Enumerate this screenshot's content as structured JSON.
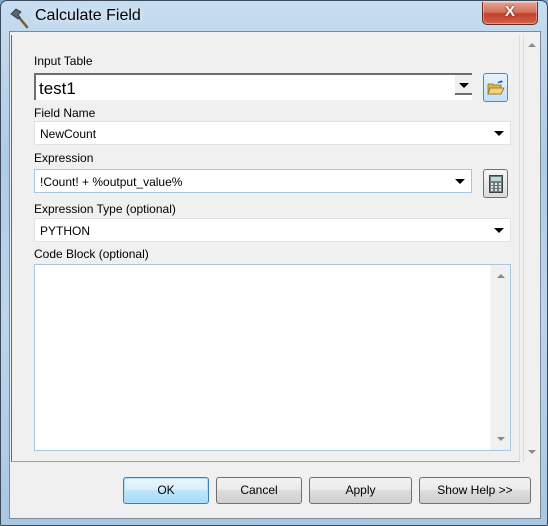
{
  "window": {
    "title": "Calculate Field",
    "title_icon": "hammer-icon",
    "close_label": "X"
  },
  "form": {
    "input_table": {
      "label": "Input Table",
      "value": "test1",
      "browse_icon": "open-folder-icon"
    },
    "field_name": {
      "label": "Field Name",
      "value": "NewCount"
    },
    "expression": {
      "label": "Expression",
      "value": "!Count! + %output_value%",
      "calculator_icon": "calculator-icon"
    },
    "expression_type": {
      "label": "Expression Type (optional)",
      "value": "PYTHON"
    },
    "code_block": {
      "label": "Code Block (optional)",
      "value": ""
    }
  },
  "buttons": {
    "ok": "OK",
    "cancel": "Cancel",
    "apply": "Apply",
    "show_help": "Show Help >>"
  },
  "colors": {
    "close_button": "#c7432c",
    "default_button_border": "#3c7fb1",
    "dialog_bg": "#f0f0f0"
  }
}
